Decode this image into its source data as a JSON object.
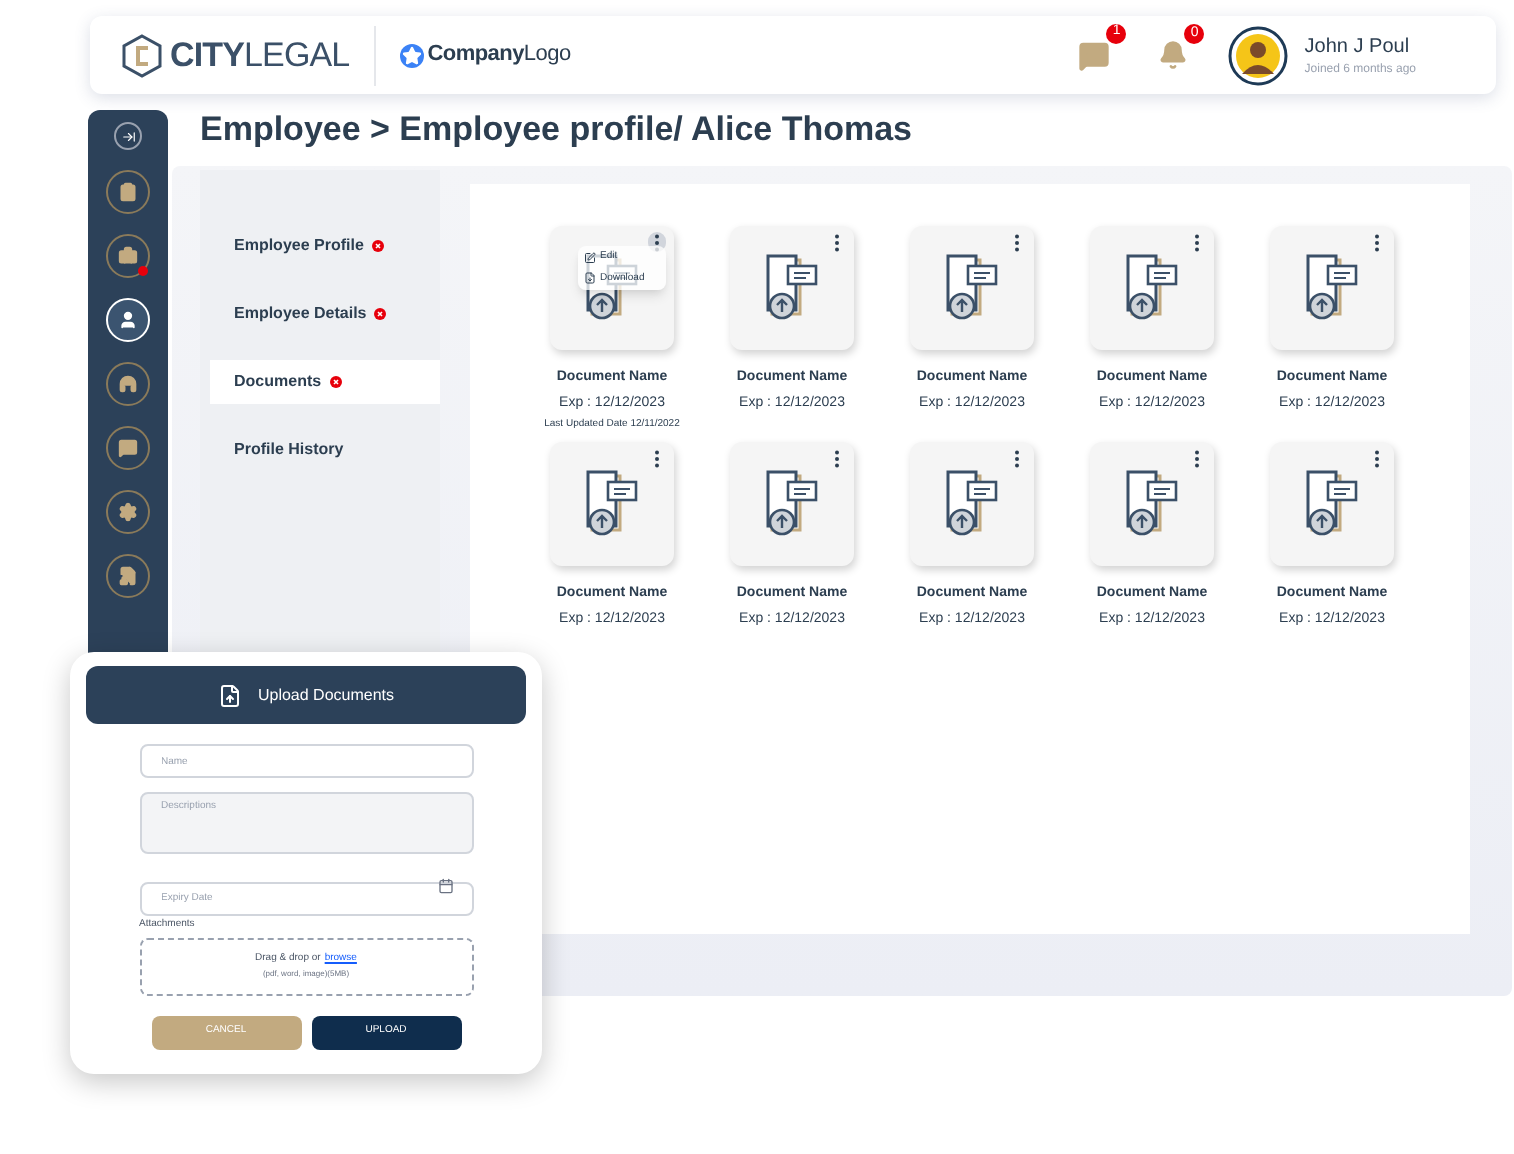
{
  "header": {
    "brand": {
      "city": "CITY",
      "legal": "LEGAL"
    },
    "company_logo": {
      "bold": "Company",
      "rest": "Logo"
    },
    "messages_badge": "1",
    "notifications_badge": "0",
    "user": {
      "name": "John J Poul",
      "subtitle": "Joined 6 months ago"
    }
  },
  "sidebar": {
    "items": [
      {
        "kind": "clipboard",
        "selected": false,
        "alert": false
      },
      {
        "kind": "briefcase",
        "selected": false,
        "alert": true
      },
      {
        "kind": "user",
        "selected": true,
        "alert": false
      },
      {
        "kind": "headphones",
        "selected": false,
        "alert": false
      },
      {
        "kind": "chat",
        "selected": false,
        "alert": false
      },
      {
        "kind": "settings",
        "selected": false,
        "alert": false
      },
      {
        "kind": "file",
        "selected": false,
        "alert": false
      }
    ]
  },
  "page_title": "Employee > Employee profile/ Alice Thomas",
  "profile_nav": [
    {
      "label": "Employee Profile",
      "selected": false,
      "error": true
    },
    {
      "label": "Employee Details",
      "selected": false,
      "error": true
    },
    {
      "label": "Documents",
      "selected": true,
      "error": true
    },
    {
      "label": "Profile History",
      "selected": false,
      "error": false
    }
  ],
  "documents": [
    {
      "name": "Document Name",
      "exp": "Exp : 12/12/2023",
      "last_updated": "Last Updated Date 12/11/2022",
      "menu_open": true,
      "menu": [
        {
          "kind": "edit",
          "label": "Edit"
        },
        {
          "kind": "download",
          "label": "Download"
        }
      ]
    },
    {
      "name": "Document Name",
      "exp": "Exp : 12/12/2023",
      "menu_open": false
    },
    {
      "name": "Document Name",
      "exp": "Exp : 12/12/2023",
      "menu_open": false
    },
    {
      "name": "Document Name",
      "exp": "Exp : 12/12/2023",
      "menu_open": false
    },
    {
      "name": "Document Name",
      "exp": "Exp : 12/12/2023",
      "menu_open": false
    },
    {
      "name": "Document Name",
      "exp": "Exp : 12/12/2023",
      "menu_open": false
    },
    {
      "name": "Document Name",
      "exp": "Exp : 12/12/2023",
      "menu_open": false
    },
    {
      "name": "Document Name",
      "exp": "Exp : 12/12/2023",
      "menu_open": false
    },
    {
      "name": "Document Name",
      "exp": "Exp : 12/12/2023",
      "menu_open": false
    },
    {
      "name": "Document Name",
      "exp": "Exp : 12/12/2023",
      "menu_open": false
    }
  ],
  "upload_dialog": {
    "title": "Upload Documents",
    "name": {
      "placeholder": "Name"
    },
    "description": {
      "placeholder": "Descriptions"
    },
    "expiry": {
      "placeholder": "Expiry Date"
    },
    "attachments_label": "Attachments",
    "drop_text": "Drag & drop or",
    "browse_link": "browse",
    "drop_hint": "(pdf, word, image)(5MB)",
    "cancel": "CANCEL",
    "upload": "UPLOAD"
  }
}
